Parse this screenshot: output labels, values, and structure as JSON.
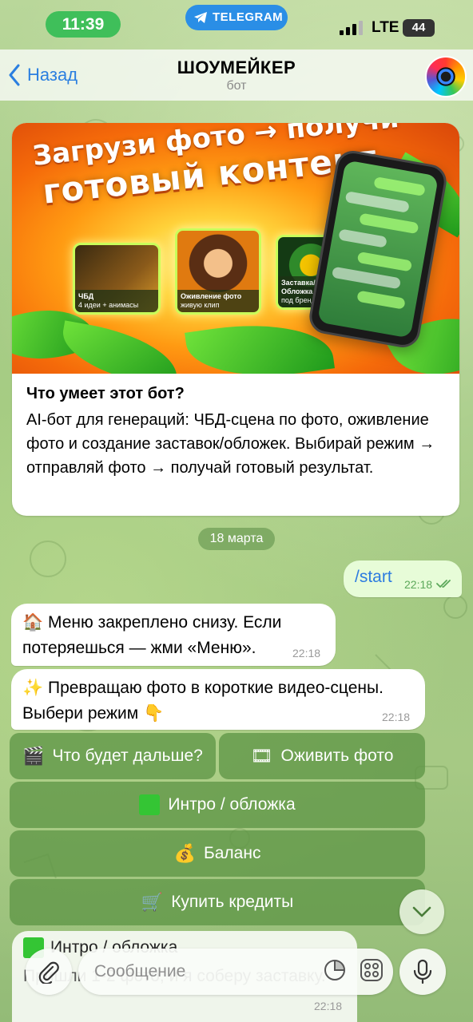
{
  "status_bar": {
    "time": "11:39",
    "app_badge": "TELEGRAM",
    "network": "LTE",
    "battery": "44"
  },
  "header": {
    "back_label": "Назад",
    "title": "ШОУМЕЙКЕР",
    "subtitle": "бот"
  },
  "intro_card": {
    "banner": {
      "headline_1": "Загрузи фото → получи",
      "headline_2": "готовый контент",
      "cards": [
        {
          "title": "ЧБД",
          "subtitle": "4 идеи + анимасы"
        },
        {
          "title": "Оживление фото",
          "subtitle": "живую клип"
        },
        {
          "title": "Заставка/Обложка",
          "subtitle": "под бренд"
        }
      ]
    },
    "title": "Что умеет этот бот?",
    "body": "AI-бот  для генераций: ЧБД-сцена по фото, оживление фото и создание заставок/обложек. Выбирай режим → отправляй фото → получай готовый результат."
  },
  "date_divider": "18 марта",
  "messages": {
    "outgoing": {
      "text": "/start",
      "time": "22:18"
    },
    "incoming_1": {
      "text": "🏠 Меню закреплено снизу. Если потеряешься — жми «Меню».",
      "time": "22:18"
    },
    "incoming_2": {
      "text": "✨ Превращаю фото в короткие видео-сцены. Выбери режим 👇",
      "time": "22:18"
    }
  },
  "keyboard": {
    "what_next": {
      "emoji": "🎬",
      "label": "Что будет дальше?"
    },
    "animate": {
      "emoji": "🎞",
      "label": "Оживить фото"
    },
    "intro": {
      "label": "Интро / обложка"
    },
    "balance": {
      "emoji": "💰",
      "label": "Баланс"
    },
    "buy": {
      "emoji": "🛒",
      "label": "Купить кредиты"
    }
  },
  "pinned_message": {
    "title": "Интро / обложка",
    "body": "Пришли 1-2 фото, и я соберу заставку.",
    "time": "22:18"
  },
  "input": {
    "placeholder": "Сообщение"
  },
  "colors": {
    "accent": "#2b7fe0",
    "outgoing_bubble": "#e7fcd8",
    "keyboard_button": "#5f9646",
    "time_pill": "#3fbf5a"
  },
  "icons": [
    "chevron-left-icon",
    "telegram-plane-icon",
    "signal-icon",
    "check-double-icon",
    "chevron-down-icon",
    "paperclip-icon",
    "sticker-icon",
    "bot-commands-icon",
    "microphone-icon"
  ]
}
